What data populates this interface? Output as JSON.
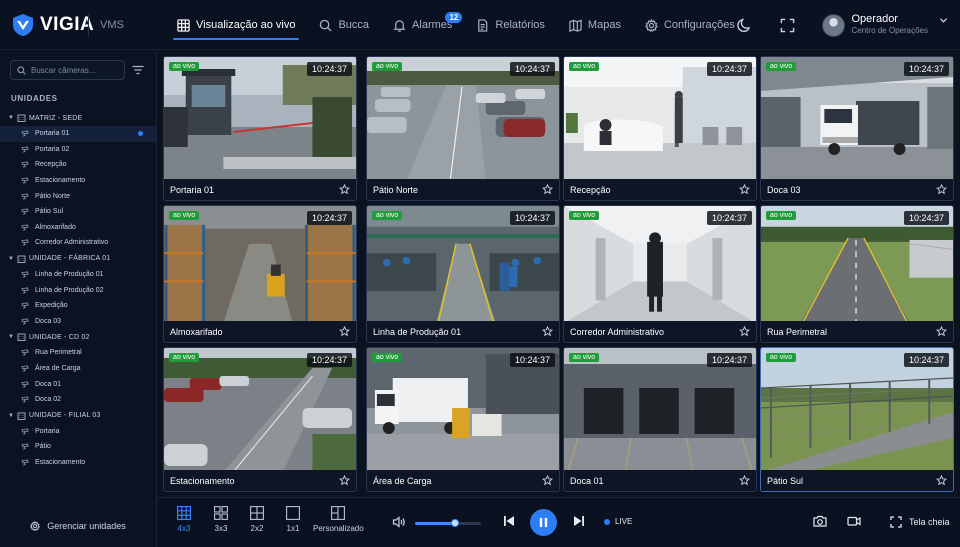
{
  "app": {
    "logo_text": "VIGIA",
    "subtitle": "VMS"
  },
  "nav": [
    {
      "label": "Visualização ao vivo",
      "icon": "grid-icon",
      "active": true
    },
    {
      "label": "Bucca",
      "icon": "search-icon"
    },
    {
      "label": "Alarmes",
      "icon": "bell-icon",
      "badge": "12"
    },
    {
      "label": "Relatórios",
      "icon": "document-icon"
    },
    {
      "label": "Mapas",
      "icon": "map-icon"
    },
    {
      "label": "Configurações",
      "icon": "gear-icon"
    }
  ],
  "user": {
    "name": "Operador",
    "role": "Centro de Operações"
  },
  "sidebar": {
    "search_placeholder": "Buscar câmeras...",
    "title": "UNIDADES",
    "groups": [
      {
        "label": "MATRIZ - SEDE",
        "cameras": [
          "Portaria 01",
          "Portaria 02",
          "Recepção",
          "Estacionamento",
          "Pátio Norte",
          "Pátio Sul",
          "Almoxarifado",
          "Corredor Administrativo"
        ]
      },
      {
        "label": "UNIDADE - FÁBRICA 01",
        "cameras": [
          "Linha de Produção 01",
          "Linha de Produção 02",
          "Expedição",
          "Doca 03"
        ]
      },
      {
        "label": "UNIDADE - CD 02",
        "cameras": [
          "Rua Perimetral",
          "Área de Carga",
          "Doca 01",
          "Doca 02"
        ]
      },
      {
        "label": "UNIDADE - FILIAL 03",
        "cameras": [
          "Portaria",
          "Pátio",
          "Estacionamento"
        ]
      }
    ],
    "manage_label": "Gerenciar unidades"
  },
  "grid": {
    "live_label": "ao vivo",
    "time": "10:24:37",
    "tiles": [
      {
        "name": "Portaria 01",
        "scene": "gate"
      },
      {
        "name": "Pátio Norte",
        "scene": "parking"
      },
      {
        "name": "Recepção",
        "scene": "lobby"
      },
      {
        "name": "Doca 03",
        "scene": "truck"
      },
      {
        "name": "Almoxarifado",
        "scene": "warehouse"
      },
      {
        "name": "Linha de Produção 01",
        "scene": "factory"
      },
      {
        "name": "Corredor Administrativo",
        "scene": "corridor"
      },
      {
        "name": "Rua Perimetral",
        "scene": "road"
      },
      {
        "name": "Estacionamento",
        "scene": "lot"
      },
      {
        "name": "Área de Carga",
        "scene": "cargo"
      },
      {
        "name": "Doca 01",
        "scene": "docks"
      },
      {
        "name": "Pátio Sul",
        "scene": "fence"
      }
    ]
  },
  "bottom": {
    "layouts": [
      "4x3",
      "3x3",
      "2x2",
      "1x1",
      "Personalizado"
    ],
    "volume": 0.6,
    "live_label": "LIVE",
    "fullscreen_label": "Tela cheia"
  }
}
